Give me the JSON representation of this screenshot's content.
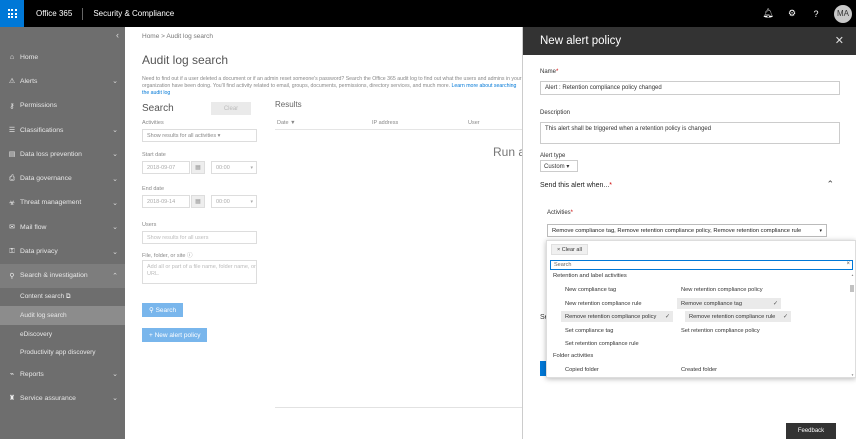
{
  "topbar": {
    "brand": "Office 365",
    "app": "Security & Compliance",
    "avatar": "MA",
    "icons": [
      "bell-icon",
      "gear-icon",
      "help-icon"
    ]
  },
  "sidebar": {
    "items": [
      {
        "label": "Home",
        "icon": "home-icon",
        "chevron": false
      },
      {
        "label": "Alerts",
        "icon": "alert-icon",
        "chevron": true
      },
      {
        "label": "Permissions",
        "icon": "permissions-icon",
        "chevron": false
      },
      {
        "label": "Classifications",
        "icon": "classifications-icon",
        "chevron": true
      },
      {
        "label": "Data loss prevention",
        "icon": "dlp-icon",
        "chevron": true
      },
      {
        "label": "Data governance",
        "icon": "governance-icon",
        "chevron": true
      },
      {
        "label": "Threat management",
        "icon": "threat-icon",
        "chevron": true
      },
      {
        "label": "Mail flow",
        "icon": "mail-icon",
        "chevron": true
      },
      {
        "label": "Data privacy",
        "icon": "privacy-icon",
        "chevron": true
      },
      {
        "label": "Search & investigation",
        "icon": "search-icon",
        "chevron": true
      }
    ],
    "sub_items": [
      {
        "label": "Content search ⧉"
      },
      {
        "label": "Audit log search"
      },
      {
        "label": "eDiscovery"
      },
      {
        "label": "Productivity app discovery"
      }
    ],
    "bottom_items": [
      {
        "label": "Reports",
        "icon": "reports-icon"
      },
      {
        "label": "Service assurance",
        "icon": "service-icon"
      }
    ]
  },
  "main": {
    "breadcrumb": "Home  >  Audit log search",
    "title": "Audit log search",
    "intro": "Need to find out if a user deleted a document or if an admin reset someone's password? Search the Office 365 audit log to find out what the users and admins in your organization have been doing. You'll find activity related to email, groups, documents, permissions, directory services, and much more.",
    "intro_link": "Learn more about searching the audit log",
    "search_title": "Search",
    "clear_label": "Clear",
    "results_title": "Results",
    "activities_label": "Activities",
    "activities_value": "Show results for all activities  ▾",
    "start_label": "Start date",
    "start_date": "2018-09-07",
    "start_time": "00:00",
    "end_label": "End date",
    "end_date": "2018-09-14",
    "end_time": "00:00",
    "users_label": "Users",
    "users_placeholder": "Show results for all users",
    "file_label": "File, folder, or site",
    "file_placeholder": "Add all or part of a file name, folder name, or URL.",
    "search_btn": "Search",
    "new_alert_btn": "+ New alert policy",
    "columns": {
      "date": "Date ▼",
      "ip": "IP address",
      "user": "User"
    },
    "run_text": "Run a"
  },
  "panel": {
    "title": "New alert policy",
    "name_label": "Name",
    "name_value": "Alert : Retention compliance policy changed",
    "desc_label": "Description",
    "desc_value": "This alert shall be triggered when a retention policy is changed",
    "type_label": "Alert type",
    "type_value": "Custom  ▾",
    "section_title": "Send this alert when...",
    "activities_label": "Activities",
    "activities_value": "Remove compliance tag,  Remove retention compliance policy,  Remove retention compliance rule",
    "feedback": "Feedback",
    "hidden_letter": "Se"
  },
  "dropdown": {
    "chip": "×  Clear all",
    "search_placeholder": "Search",
    "group1": "Retention and label activities",
    "left_options": [
      {
        "label": "New compliance tag",
        "selected": false
      },
      {
        "label": "New retention compliance rule",
        "selected": false
      },
      {
        "label": "Remove retention compliance policy",
        "selected": true
      },
      {
        "label": "Set compliance tag",
        "selected": false
      },
      {
        "label": "Set retention compliance rule",
        "selected": false
      }
    ],
    "right_options": [
      {
        "label": "New retention compliance policy",
        "selected": false
      },
      {
        "label": "Remove compliance tag",
        "selected": true
      },
      {
        "label": "Remove retention compliance rule",
        "selected": true
      },
      {
        "label": "Set retention compliance policy",
        "selected": false
      }
    ],
    "group2": "Folder activities",
    "folder_left": "Copied folder",
    "folder_right": "Created folder"
  }
}
